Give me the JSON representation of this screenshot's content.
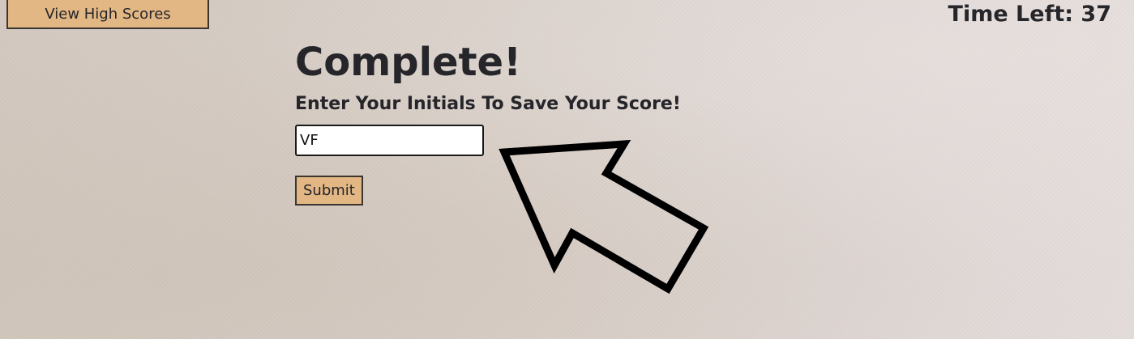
{
  "header": {
    "high_scores_label": "View High Scores",
    "timer_text": "Time Left: 37"
  },
  "main": {
    "title": "Complete!",
    "prompt": "Enter Your Initials To Save Your Score!",
    "initials_value": "VF",
    "submit_label": "Submit"
  },
  "annotation": {
    "arrow_color": "#000000",
    "arrow_icon": "arrow-pointer-icon"
  },
  "colors": {
    "button_bg": "#e2b784",
    "text": "#25252a"
  }
}
